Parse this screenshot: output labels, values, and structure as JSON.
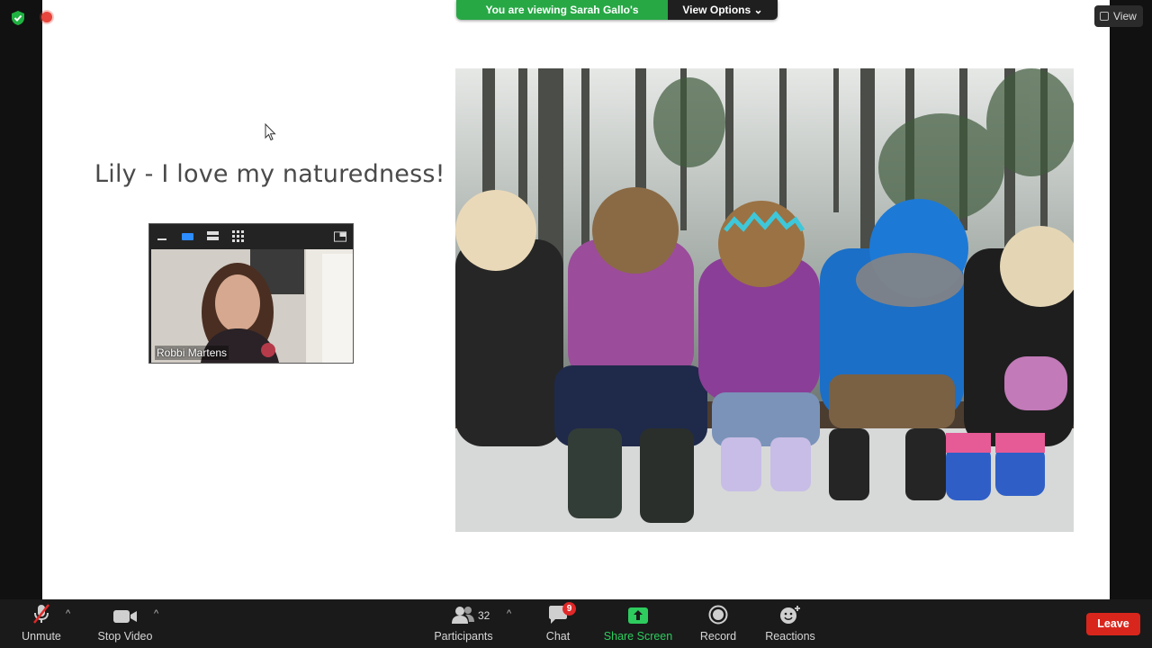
{
  "banner": {
    "viewing_text": "You are viewing Sarah Gallo's screen",
    "view_options_label": "View Options"
  },
  "view_button": {
    "label": "View"
  },
  "slide": {
    "title": "Lily - I love my naturedness!"
  },
  "video_panel": {
    "participant_name": "Robbi Martens"
  },
  "toolbar": {
    "unmute_label": "Unmute",
    "stop_video_label": "Stop Video",
    "participants_label": "Participants",
    "participants_count": "32",
    "chat_label": "Chat",
    "chat_badge": "9",
    "share_screen_label": "Share Screen",
    "record_label": "Record",
    "reactions_label": "Reactions",
    "leave_label": "Leave"
  },
  "colors": {
    "banner_green": "#27a845",
    "share_green": "#2ecc5e",
    "leave_red": "#d9261c",
    "badge_red": "#e02828",
    "active_layout_blue": "#2d8cff"
  },
  "icons": [
    "shield-icon",
    "record-indicator-icon",
    "cursor-icon",
    "microphone-muted-icon",
    "video-camera-icon",
    "participants-icon",
    "chat-icon",
    "share-screen-icon",
    "record-icon",
    "reactions-icon",
    "minimize-icon",
    "speaker-view-icon",
    "strip-view-icon",
    "gallery-view-icon",
    "exit-panel-icon"
  ]
}
